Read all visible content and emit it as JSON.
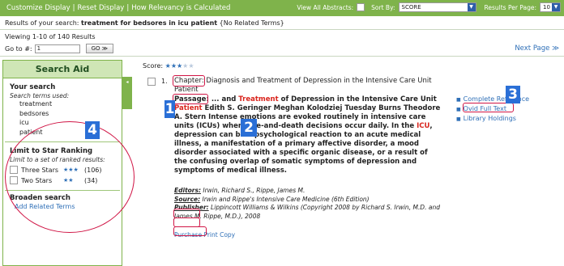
{
  "toolbar": {
    "customize": "Customize Display",
    "reset": "Reset Display",
    "relevancy": "How Relevancy is Calculated",
    "view_abstracts": "View All Abstracts:",
    "sort_by_label": "Sort By:",
    "sort_by_value": "SCORE",
    "per_page_label": "Results Per Page:",
    "per_page_value": "10",
    "sep": "|"
  },
  "summary": {
    "prefix": "Results of your search:",
    "query": "treatment for bedsores in icu patient",
    "suffix": "{No Related Terms}"
  },
  "paging": {
    "viewing": "Viewing 1-10 of 140 Results",
    "goto_label": "Go to #:",
    "goto_value": "1",
    "go_button": "GO ≫",
    "next": "Next Page ≫"
  },
  "sidebar": {
    "title": "Search Aid",
    "tab_glyph": "◂",
    "your_search": "Your search",
    "terms_used": "Search terms used:",
    "terms": [
      "treatment",
      "bedsores",
      "icu",
      "patient"
    ],
    "limit_title": "Limit to Star Ranking",
    "limit_sub": "Limit to a set of ranked results:",
    "stars": [
      {
        "label": "Three Stars",
        "glyph": "★★★",
        "count": "(106)"
      },
      {
        "label": "Two Stars",
        "glyph": "★★",
        "count": "(34)"
      }
    ],
    "broaden": "Broaden search",
    "add_related": "Add Related Terms"
  },
  "result": {
    "score_label": "Score:",
    "score_on": "★★★",
    "score_off": "★★",
    "number": "1.",
    "chapter_label": "Chapter:",
    "chapter_text": "Diagnosis and Treatment of Depression in the Intensive Care Unit Patient",
    "passage_label": "Passage:",
    "p1": "... and ",
    "p_treatment": "Treatment",
    "p2": " of Depression in the Intensive Care Unit ",
    "p_patient": "Patient",
    "p3": " Edith S. Geringer Meghan Kolodziej Tuesday Burns Theodore A. Stern Intense emotions are evoked routinely in intensive care units (ICUs) where life-and-death decisions occur daily. In the ",
    "p_icu": "ICU",
    "p4": ", depression can be a psychological reaction to an acute medical illness, a manifestation of a primary affective disorder, a mood disorder associated with a specific organic disease, or a result of the confusing overlap of somatic symptoms of depression and symptoms of medical illness.",
    "editors_label": "Editors:",
    "editors": " Irwin, Richard S., Rippe, James M.",
    "source_label": "Source:",
    "source": " Irwin and Rippe's Intensive Care Medicine (6th Edition)",
    "publisher_label": "Publisher:",
    "publisher": " Lippincott Williams & Wilkins (Copyright 2008 by Richard S. Irwin, M.D. and James M. Rippe, M.D.), 2008",
    "purchase": "Purchase Print Copy"
  },
  "links": {
    "bullet": "■",
    "complete_ref": "Complete Reference",
    "ovid": "Ovid Full Text",
    "library": "Library Holdings"
  },
  "annotations": {
    "one": "1",
    "two": "2",
    "three": "3",
    "four": "4"
  },
  "colors": {
    "toolbar_bg": "#7fb34b",
    "sidebar_header_bg": "#cfe6b6",
    "highlight": "#d9251d",
    "link": "#2e6fb7",
    "annotation_red": "#d01545",
    "annotation_blue": "#2a6fd6"
  }
}
